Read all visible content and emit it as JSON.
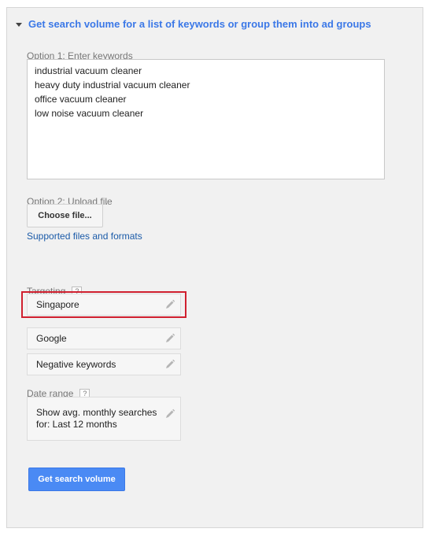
{
  "section": {
    "title": "Get search volume for a list of keywords or group them into ad groups"
  },
  "option1": {
    "label": "Option 1: Enter keywords",
    "keywords": [
      "industrial vacuum cleaner",
      "heavy duty industrial vacuum cleaner",
      "office vacuum cleaner",
      "low noise vacuum cleaner"
    ]
  },
  "option2": {
    "label": "Option 2: Upload file",
    "choose_button": "Choose file...",
    "supported_link": "Supported files and formats"
  },
  "targeting": {
    "label": "Targeting",
    "help": "?",
    "items": [
      {
        "label": "Singapore",
        "icon": "pencil-icon"
      },
      {
        "label": "Google",
        "icon": "pencil-icon"
      },
      {
        "label": "Negative keywords",
        "icon": "pencil-icon"
      }
    ]
  },
  "date_range": {
    "label": "Date range",
    "help": "?",
    "line1": "Show avg. monthly searches",
    "line2": "for: Last 12 months"
  },
  "submit": {
    "label": "Get search volume"
  },
  "colors": {
    "accent": "#3b78e7",
    "link": "#1a5aa8",
    "button_primary": "#4a8af4",
    "highlight": "#d0202f",
    "panel_bg": "#f1f1f1"
  }
}
